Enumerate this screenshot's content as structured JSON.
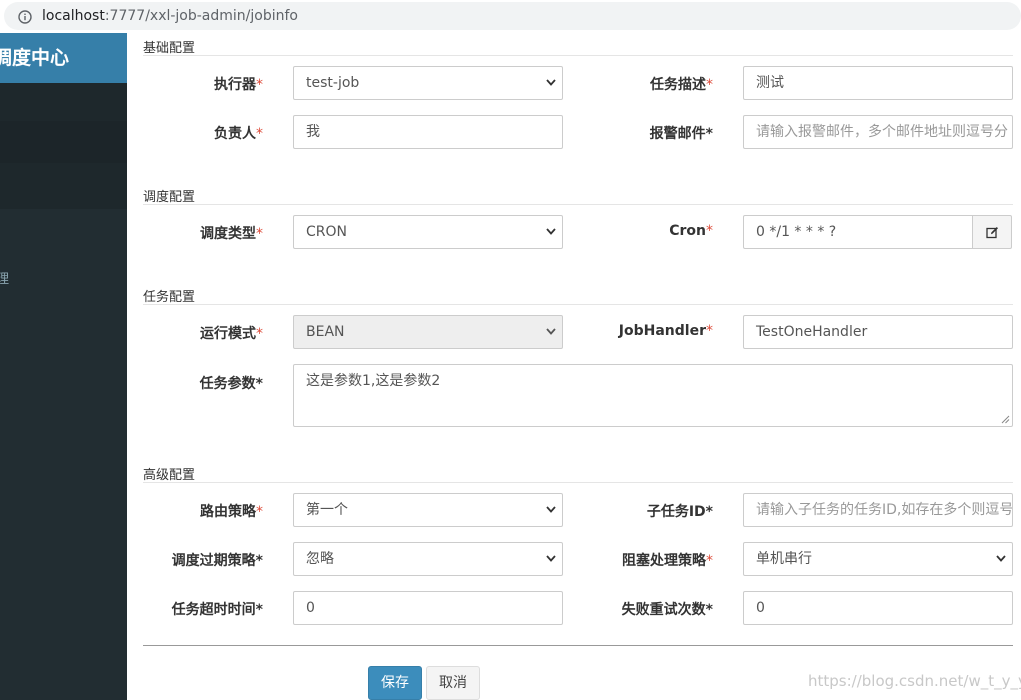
{
  "browser": {
    "url_host": "localhost",
    "url_path": ":7777/xxl-job-admin/jobinfo"
  },
  "sidebar": {
    "brand": "调度中心",
    "partial_glyph": "理"
  },
  "sections": {
    "basic": "基础配置",
    "schedule": "调度配置",
    "task": "任务配置",
    "advanced": "高级配置"
  },
  "fields": {
    "executor": {
      "label": "执行器",
      "required": "*",
      "value": "test-job"
    },
    "job_desc": {
      "label": "任务描述",
      "required": "*",
      "value": "测试"
    },
    "author": {
      "label": "负责人",
      "required": "*",
      "value": "我"
    },
    "alarm_email": {
      "label": "报警邮件*",
      "placeholder": "请输入报警邮件，多个邮件地址则逗号分"
    },
    "schedule_type": {
      "label": "调度类型",
      "required": "*",
      "value": "CRON"
    },
    "cron": {
      "label": "Cron",
      "required": "*",
      "value": "0 */1 * * * ?"
    },
    "run_mode": {
      "label": "运行模式",
      "required": "*",
      "value": "BEAN"
    },
    "job_handler": {
      "label": "JobHandler",
      "required": "*",
      "value": "TestOneHandler"
    },
    "job_param": {
      "label": "任务参数*",
      "value": "这是参数1,这是参数2"
    },
    "route_strategy": {
      "label": "路由策略",
      "required": "*",
      "value": "第一个"
    },
    "child_job_id": {
      "label": "子任务ID*",
      "placeholder": "请输入子任务的任务ID,如存在多个则逗号"
    },
    "misfire_strategy": {
      "label": "调度过期策略*",
      "value": "忽略"
    },
    "block_strategy": {
      "label": "阻塞处理策略",
      "required": "*",
      "value": "单机串行"
    },
    "timeout": {
      "label": "任务超时时间*",
      "value": "0"
    },
    "fail_retry": {
      "label": "失败重试次数*",
      "value": "0"
    }
  },
  "actions": {
    "save": "保存",
    "cancel": "取消"
  },
  "watermark": "https://blog.csdn.net/w_t_y_y",
  "colors": {
    "brand_bg": "#367fa9",
    "sidebar_bg": "#222d32",
    "primary_button": "#3c8dbc",
    "required_mark": "#dd4b39"
  }
}
